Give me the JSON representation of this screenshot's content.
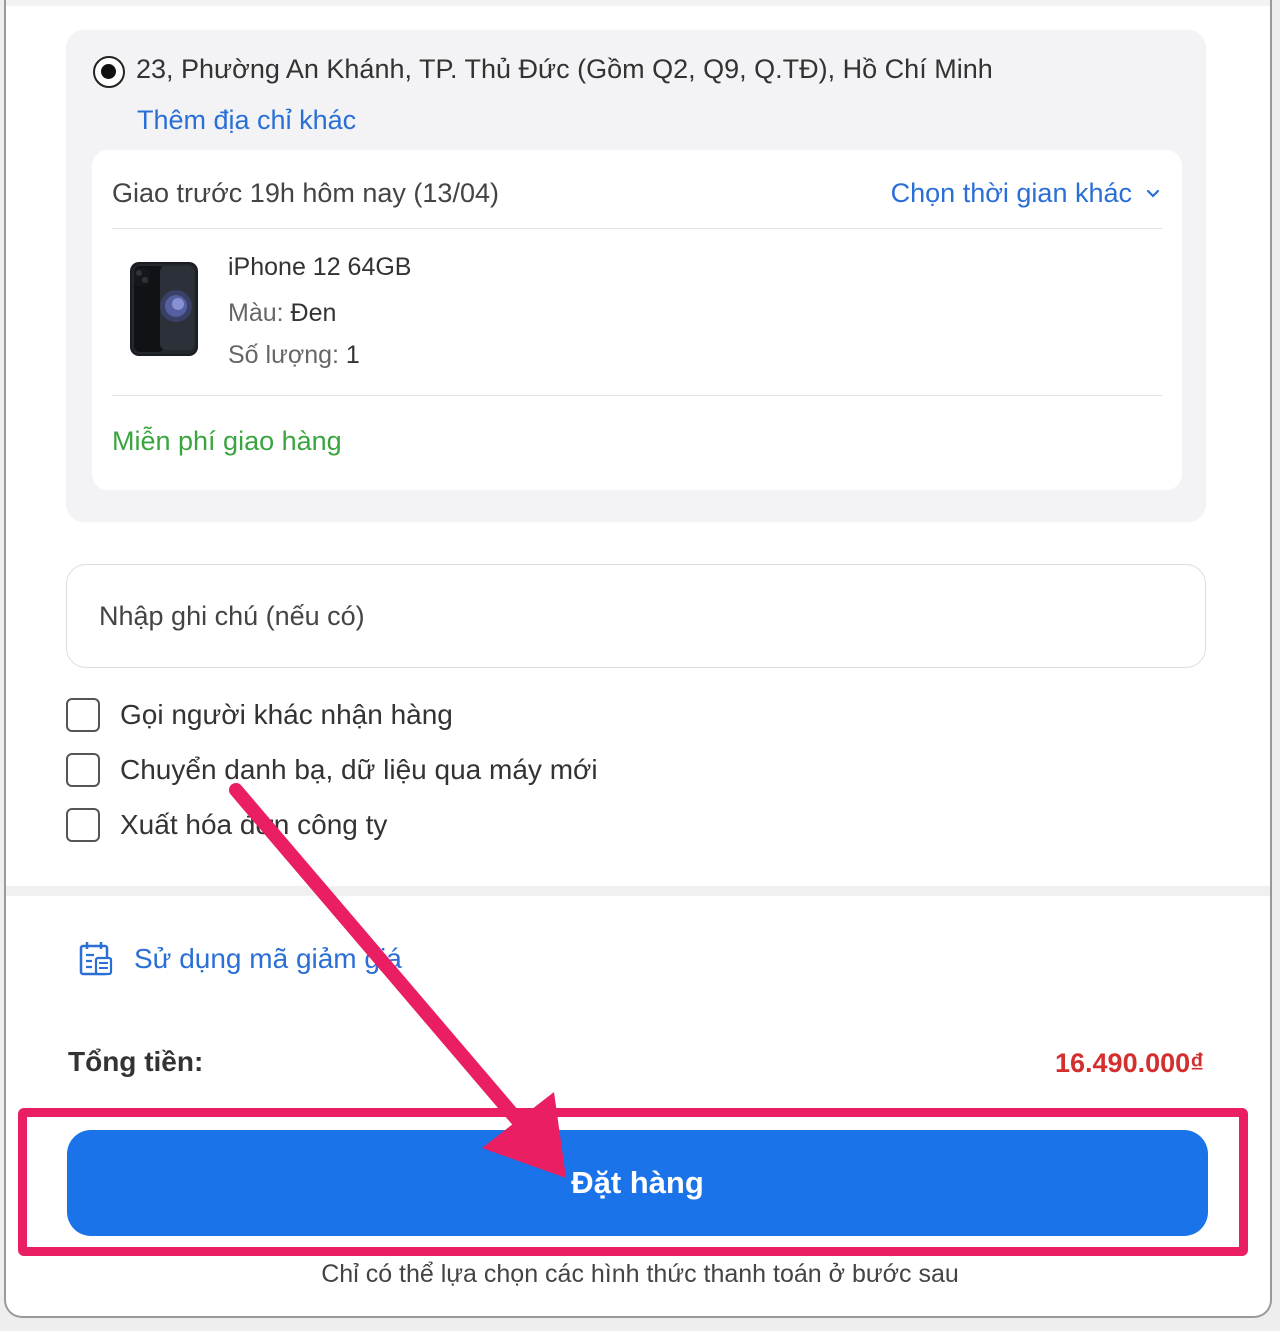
{
  "address": {
    "selected_text": "23, Phường An Khánh, TP. Thủ Đức (Gồm Q2, Q9, Q.TĐ), Hồ Chí Minh",
    "add_other_label": "Thêm địa chỉ khác"
  },
  "delivery": {
    "time_text": "Giao trước 19h hôm nay (13/04)",
    "choose_time_label": "Chọn thời gian khác",
    "free_shipping_text": "Miễn phí giao hàng"
  },
  "product": {
    "name": "iPhone 12 64GB",
    "color_label": "Màu:",
    "color_value": "Đen",
    "quantity_label": "Số lượng:",
    "quantity_value": "1"
  },
  "note": {
    "placeholder": "Nhập ghi chú (nếu có)"
  },
  "options": [
    {
      "label": "Gọi người khác nhận hàng",
      "checked": false
    },
    {
      "label": "Chuyển danh bạ, dữ liệu qua máy mới",
      "checked": false
    },
    {
      "label": "Xuất hóa đơn công ty",
      "checked": false
    }
  ],
  "coupon": {
    "label": "Sử dụng mã giảm giá",
    "icon": "coupon-icon"
  },
  "total": {
    "label": "Tổng tiền:",
    "value": "16.490.000₫"
  },
  "order_button": {
    "label": "Đặt hàng"
  },
  "payment_note": "Chỉ có thể lựa chọn các hình thức thanh toán ở bước sau",
  "colors": {
    "link_blue": "#2a6fd6",
    "button_blue": "#1a73e8",
    "price_red": "#d32f2f",
    "free_green": "#3aa53f",
    "highlight_pink": "#e91e63"
  }
}
